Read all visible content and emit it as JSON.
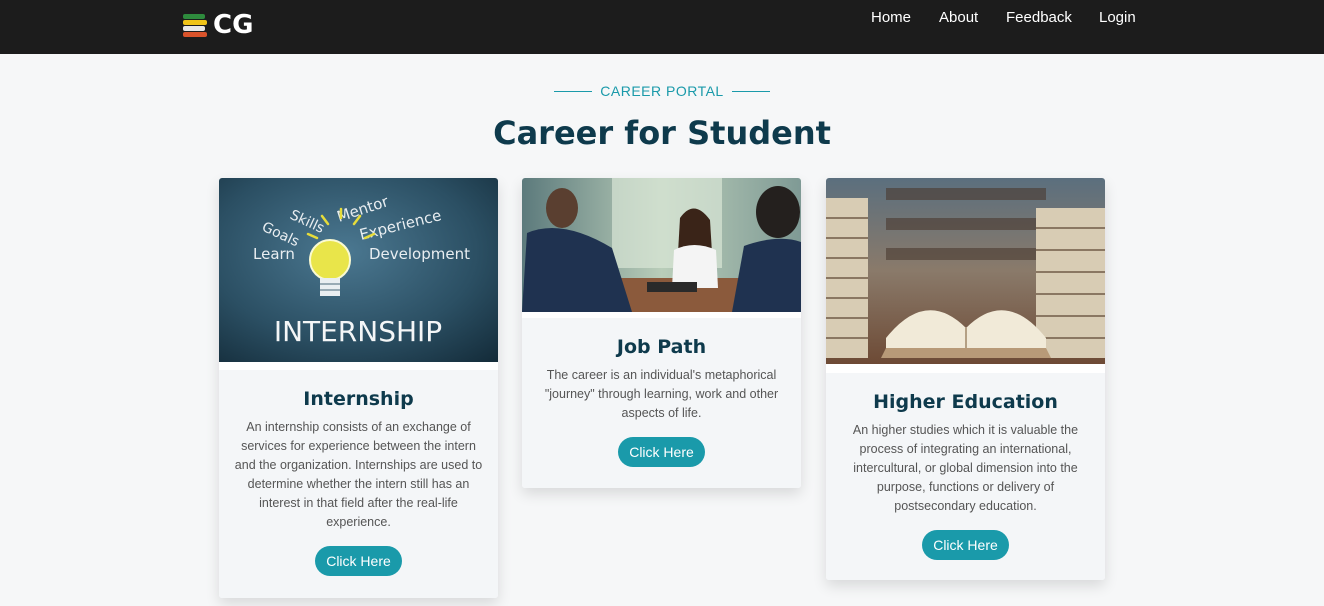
{
  "brand": {
    "name": "CG"
  },
  "nav": {
    "items": [
      "Home",
      "About",
      "Feedback",
      "Login"
    ]
  },
  "section": {
    "tag": "CAREER PORTAL",
    "title": "Career for Student"
  },
  "cards": [
    {
      "title": "Internship",
      "text": "An internship consists of an exchange of services for experience between the intern and the organization. Internships are used to determine whether the intern still has an interest in that field after the real-life experience.",
      "button": "Click Here",
      "image_words": {
        "skills": "Skills",
        "mentor": "Mentor",
        "goals": "Goals",
        "experience": "Experience",
        "learn": "Learn",
        "development": "Development",
        "headline": "INTERNSHIP"
      }
    },
    {
      "title": "Job Path",
      "text": "The career is an individual's metaphorical \"journey\" through learning, work and other aspects of life.",
      "button": "Click Here"
    },
    {
      "title": "Higher Education",
      "text": "An higher studies which it is valuable the process of integrating an international, intercultural, or global dimension into the purpose, functions or delivery of postsecondary education.",
      "button": "Click Here"
    }
  ],
  "colors": {
    "accent": "#1a9aaa",
    "title": "#0e3a4c",
    "navbar": "#1c1c1c"
  },
  "icons": [
    "books-logo-icon"
  ]
}
